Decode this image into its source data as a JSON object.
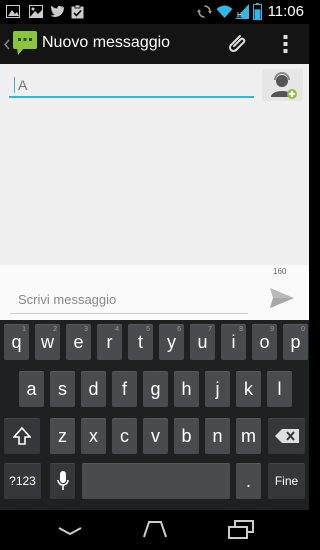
{
  "status_bar": {
    "time": "11:06",
    "battery_level": 0.7,
    "icons": [
      "gallery-notification-icon",
      "twitter-notification-icon",
      "clipboard-notification-icon",
      "sync-icon",
      "wifi-icon",
      "signal-icon",
      "battery-icon"
    ]
  },
  "action_bar": {
    "title": "Nuovo messaggio",
    "icons": [
      "back-caret-icon",
      "messaging-app-icon",
      "attach-icon",
      "overflow-menu-icon"
    ]
  },
  "recipient": {
    "placeholder": "A",
    "value": ""
  },
  "compose": {
    "char_count": "160",
    "placeholder": "Scrivi messaggio"
  },
  "keyboard": {
    "row1": [
      {
        "label": "q",
        "hint": "1"
      },
      {
        "label": "w",
        "hint": "2"
      },
      {
        "label": "e",
        "hint": "3"
      },
      {
        "label": "r",
        "hint": "4"
      },
      {
        "label": "t",
        "hint": "5"
      },
      {
        "label": "y",
        "hint": "6"
      },
      {
        "label": "u",
        "hint": "7"
      },
      {
        "label": "i",
        "hint": "8"
      },
      {
        "label": "o",
        "hint": "9"
      },
      {
        "label": "p",
        "hint": "0"
      }
    ],
    "row2": [
      "a",
      "s",
      "d",
      "f",
      "g",
      "h",
      "j",
      "k",
      "l"
    ],
    "row3": [
      "z",
      "x",
      "c",
      "v",
      "b",
      "n",
      "m"
    ],
    "symbols_label": "?123",
    "period_label": ".",
    "done_label": "Fine"
  },
  "colors": {
    "accent": "#33b5e5",
    "actionbar": "#141414",
    "content_bg": "#f0f0f0",
    "keyboard_bg": "#1e2022",
    "key": "#494b4e"
  }
}
